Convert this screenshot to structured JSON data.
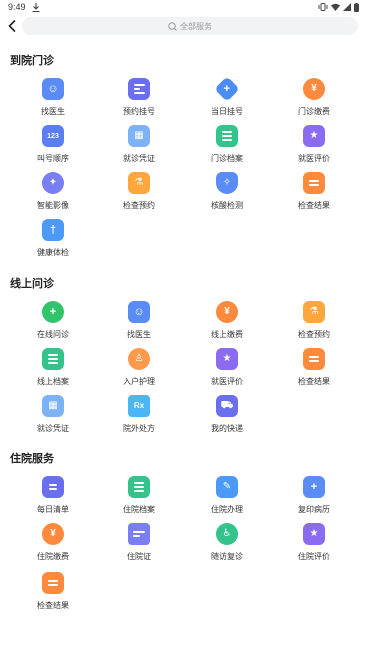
{
  "status_bar": {
    "time": "9:49"
  },
  "search": {
    "placeholder": "全部服务"
  },
  "colors": {
    "blue": "#5b8cf5",
    "purple": "#8b6cf0",
    "orange": "#ff8a3d",
    "green": "#33c38b",
    "light_blue": "#7db2f7"
  },
  "sections": [
    {
      "title": "到院门诊",
      "items": [
        {
          "label": "找医生",
          "icon": "doctor-icon"
        },
        {
          "label": "预约挂号",
          "icon": "appointment-icon"
        },
        {
          "label": "当日挂号",
          "icon": "same-day-register-icon"
        },
        {
          "label": "门诊缴费",
          "icon": "payment-icon"
        },
        {
          "label": "叫号顺序",
          "icon": "queue-number-icon"
        },
        {
          "label": "就诊凭证",
          "icon": "visit-voucher-icon"
        },
        {
          "label": "门诊档案",
          "icon": "records-icon"
        },
        {
          "label": "就医评价",
          "icon": "evaluation-icon"
        },
        {
          "label": "智能影像",
          "icon": "imaging-icon"
        },
        {
          "label": "检查预约",
          "icon": "exam-booking-icon"
        },
        {
          "label": "核酸检测",
          "icon": "nucleic-test-icon"
        },
        {
          "label": "检查结果",
          "icon": "exam-result-icon"
        },
        {
          "label": "健康体检",
          "icon": "health-check-icon"
        }
      ]
    },
    {
      "title": "线上问诊",
      "items": [
        {
          "label": "在线问诊",
          "icon": "online-consult-icon"
        },
        {
          "label": "找医生",
          "icon": "doctor-icon"
        },
        {
          "label": "线上缴费",
          "icon": "payment-icon"
        },
        {
          "label": "检查预约",
          "icon": "exam-booking-icon"
        },
        {
          "label": "线上档案",
          "icon": "records-icon"
        },
        {
          "label": "入户护理",
          "icon": "home-nursing-icon"
        },
        {
          "label": "就医评价",
          "icon": "evaluation-icon"
        },
        {
          "label": "检查结果",
          "icon": "exam-result-icon"
        },
        {
          "label": "就诊凭证",
          "icon": "visit-voucher-icon"
        },
        {
          "label": "院外处方",
          "icon": "prescription-icon"
        },
        {
          "label": "我的快递",
          "icon": "delivery-icon"
        }
      ]
    },
    {
      "title": "住院服务",
      "items": [
        {
          "label": "每日清单",
          "icon": "daily-list-icon"
        },
        {
          "label": "住院档案",
          "icon": "records-icon"
        },
        {
          "label": "住院办理",
          "icon": "admission-icon"
        },
        {
          "label": "复印病历",
          "icon": "copy-records-icon"
        },
        {
          "label": "住院缴费",
          "icon": "payment-icon"
        },
        {
          "label": "住院证",
          "icon": "hospital-card-icon"
        },
        {
          "label": "随访复诊",
          "icon": "follow-up-icon"
        },
        {
          "label": "住院评价",
          "icon": "evaluation-icon"
        },
        {
          "label": "检查结果",
          "icon": "exam-result-icon"
        }
      ]
    }
  ]
}
